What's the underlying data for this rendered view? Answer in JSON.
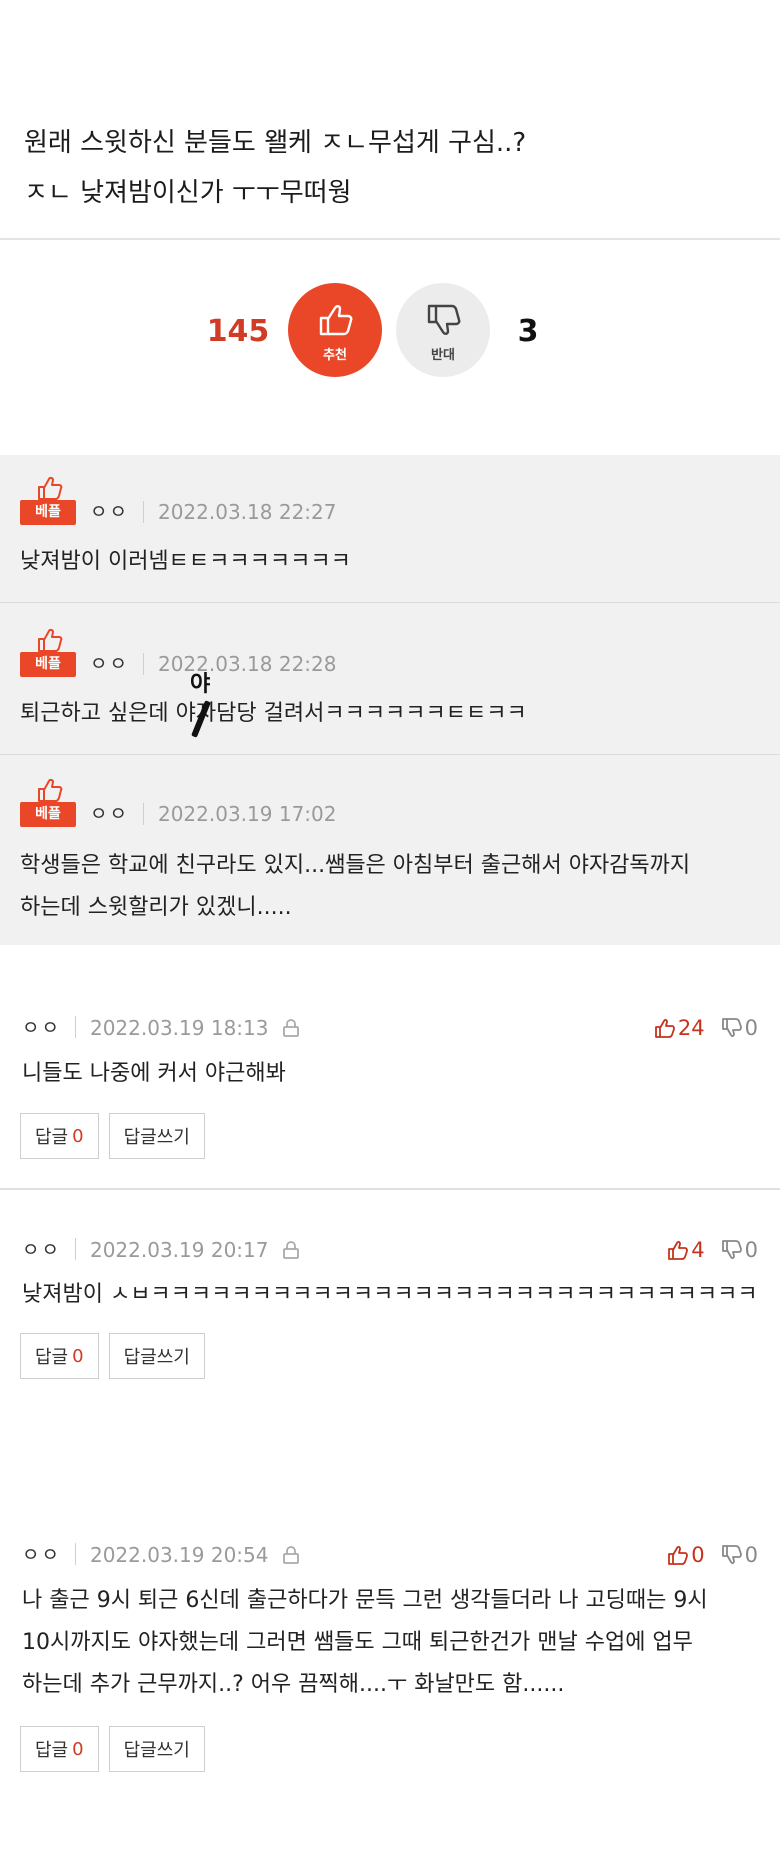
{
  "post": {
    "line1": "원래 스윗하신 분들도 왤케 ㅈㄴ무섭게 구심..?",
    "line2": "ㅈㄴ 낮져밤이신가 ㅜㅜ무떠웡"
  },
  "votes": {
    "up_count": "145",
    "up_label": "추천",
    "down_label": "반대",
    "down_count": "3",
    "up_color": "#e94727",
    "down_color": "#ececec"
  },
  "best_comments": [
    {
      "badge": "베플",
      "name": "ㅇㅇ",
      "date": "2022.03.18 22:27",
      "text": "낮져밤이 이러넴ㅌㅌㅋㅋㅋㅋㅋㅋㅋ"
    },
    {
      "badge": "베플",
      "name": "ㅇㅇ",
      "date": "2022.03.18 22:28",
      "text": "퇴근하고 싶은데 야자담당 걸려서ㅋㅋㅋㅋㅋㅋㅌㅌㅋㅋ",
      "overlay": "야"
    },
    {
      "badge": "베플",
      "name": "ㅇㅇ",
      "date": "2022.03.19 17:02",
      "text_line1": "학생들은 학교에 친구라도 있지...쌤들은 아침부터 출근해서 야자감독까지",
      "text_line2": "하는데 스윗할리가 있겠니....."
    }
  ],
  "comments": [
    {
      "name": "ㅇㅇ",
      "date": "2022.03.19 18:13",
      "up": "24",
      "down": "0",
      "text": "니들도 나중에 커서 야근해봐",
      "reply_label": "답글",
      "reply_count": "0",
      "write_label": "답글쓰기"
    },
    {
      "name": "ㅇㅇ",
      "date": "2022.03.19 20:17",
      "up": "4",
      "down": "0",
      "text": "낮져밤이 ㅅㅂㅋㅋㅋㅋㅋㅋㅋㅋㅋㅋㅋㅋㅋㅋㅋㅋㅋㅋㅋㅋㅋㅋㅋㅋㅋㅋㅋㅋㅋㅋ",
      "reply_label": "답글",
      "reply_count": "0",
      "write_label": "답글쓰기"
    },
    {
      "name": "ㅇㅇ",
      "date": "2022.03.19 20:54",
      "up": "0",
      "down": "0",
      "text_line1": "나 출근 9시 퇴근 6신데 출근하다가 문득 그런 생각들더라 나 고딩때는 9시",
      "text_line2": "10시까지도 야자했는데 그러면 쌤들도 그때 퇴근한건가 맨날 수업에 업무",
      "text_line3": "하는데 추가 근무까지..? 어우 끔찍해....ㅜ 화날만도 함......",
      "reply_label": "답글",
      "reply_count": "0",
      "write_label": "답글쓰기"
    }
  ],
  "icons": {
    "thumb_up": "thumbs-up-icon",
    "thumb_down": "thumbs-down-icon",
    "lock": "lock-icon"
  }
}
